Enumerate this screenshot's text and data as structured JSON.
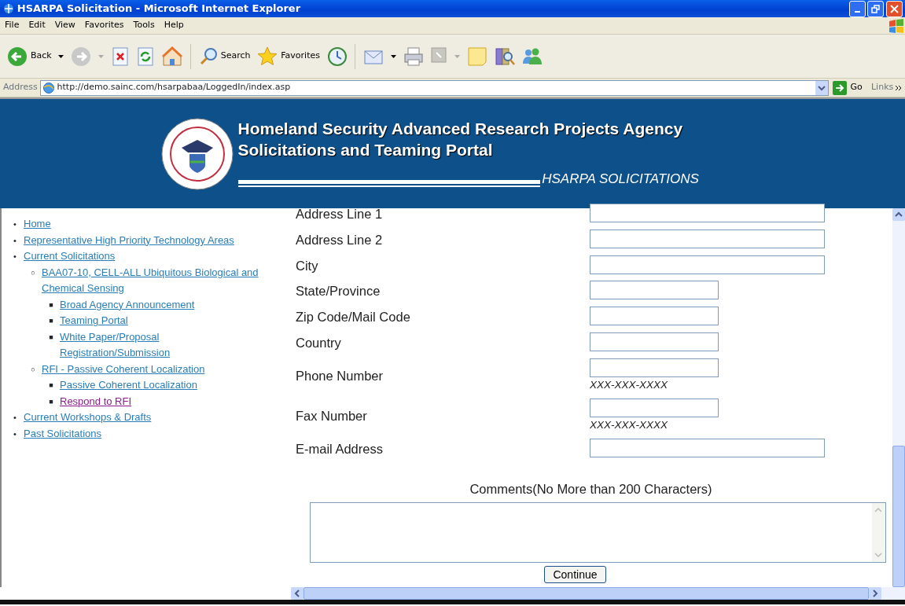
{
  "window": {
    "title": "HSARPA Solicitation - Microsoft Internet Explorer"
  },
  "menu": [
    "File",
    "Edit",
    "View",
    "Favorites",
    "Tools",
    "Help"
  ],
  "toolbar": [
    {
      "kind": "back",
      "label": "Back"
    },
    {
      "kind": "forward"
    },
    {
      "kind": "stop"
    },
    {
      "kind": "refresh"
    },
    {
      "kind": "home"
    },
    {
      "kind": "search",
      "label": "Search"
    },
    {
      "kind": "favorites",
      "label": "Favorites"
    },
    {
      "kind": "history"
    },
    {
      "kind": "mail"
    },
    {
      "kind": "print"
    },
    {
      "kind": "edit"
    },
    {
      "kind": "note"
    },
    {
      "kind": "research"
    },
    {
      "kind": "messenger"
    }
  ],
  "address_bar": {
    "label": "Address",
    "url": "http://demo.sainc.com/hsarpabaa/LoggedIn/index.asp",
    "go": "Go",
    "links": "Links"
  },
  "header": {
    "title": "Homeland Security Advanced Research Projects Agency",
    "subtitle": "Solicitations and Teaming Portal",
    "tagline": "HSARPA SOLICITATIONS"
  },
  "sidebar": {
    "items": [
      {
        "marker": "•",
        "label": "Home",
        "visited": false
      },
      {
        "marker": "•",
        "label": "Representative High Priority Technology Areas",
        "visited": false
      },
      {
        "marker": "•",
        "label": "Current Solicitations",
        "visited": false,
        "children": [
          {
            "marker": "○",
            "label": "BAA07-10, CELL-ALL Ubiquitous Biological and Chemical Sensing",
            "visited": false,
            "children": [
              {
                "marker": "■",
                "label": "Broad Agency Announcement",
                "visited": false
              },
              {
                "marker": "■",
                "label": "Teaming Portal",
                "visited": false
              },
              {
                "marker": "■",
                "label": "White Paper/Proposal Registration/Submission",
                "visited": false
              }
            ]
          },
          {
            "marker": "○",
            "label": "RFI - Passive Coherent Localization",
            "visited": false,
            "children": [
              {
                "marker": "■",
                "label": "Passive Coherent Localization",
                "visited": false
              },
              {
                "marker": "■",
                "label": "Respond to RFI",
                "visited": true
              }
            ]
          }
        ]
      },
      {
        "marker": "•",
        "label": "Current Workshops & Drafts",
        "visited": false
      },
      {
        "marker": "•",
        "label": "Past Solicitations",
        "visited": false
      }
    ]
  },
  "form": {
    "fields": [
      {
        "label": "Address Line 1",
        "kind": "long"
      },
      {
        "label": "Address Line 2",
        "kind": "long"
      },
      {
        "label": "City",
        "kind": "long"
      },
      {
        "label": "State/Province",
        "kind": "short"
      },
      {
        "label": "Zip Code/Mail Code",
        "kind": "short"
      },
      {
        "label": "Country",
        "kind": "short"
      },
      {
        "label": "Phone Number",
        "kind": "short",
        "hint": "XXX-XXX-XXXX"
      },
      {
        "label": "Fax Number",
        "kind": "short",
        "hint": "XXX-XXX-XXXX"
      },
      {
        "label": "E-mail Address",
        "kind": "long"
      }
    ],
    "comments_label": "Comments(No More than 200 Characters)",
    "submit": "Continue"
  }
}
